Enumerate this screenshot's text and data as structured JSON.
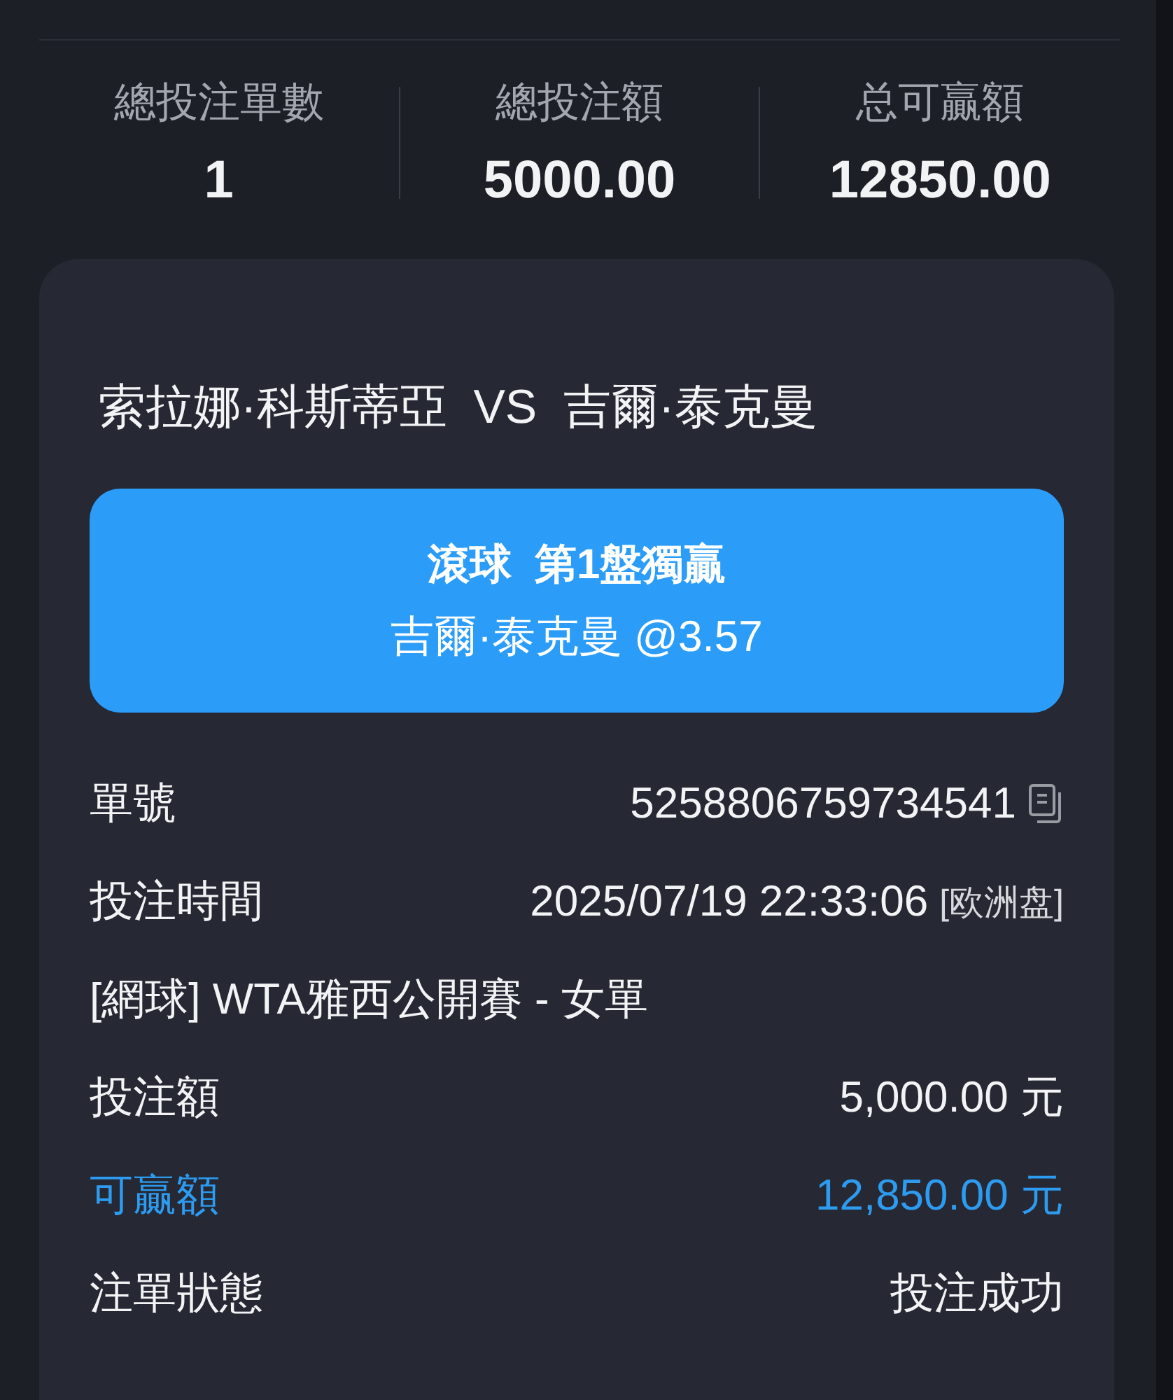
{
  "summary": [
    {
      "label": "總投注單數",
      "value": "1"
    },
    {
      "label": "總投注額",
      "value": "5000.00"
    },
    {
      "label": "总可贏額",
      "value": "12850.00"
    }
  ],
  "bet": {
    "match": "索拉娜·科斯蒂亞  VS  吉爾·泰克曼",
    "market": "滾球  第1盤獨贏",
    "selection": "吉爾·泰克曼 @3.57",
    "rows": [
      {
        "kind": "copy",
        "label": "單號",
        "value": "5258806759734541"
      },
      {
        "kind": "time",
        "label": "投注時間",
        "value": "2025/07/19 22:33:06",
        "note": "[欧洲盘]"
      },
      {
        "kind": "full",
        "label": "[網球] WTA雅西公開賽 - 女單"
      },
      {
        "kind": "plain",
        "label": "投注額",
        "value": "5,000.00 元"
      },
      {
        "kind": "highlight",
        "label": "可贏額",
        "value": "12,850.00 元"
      },
      {
        "kind": "plain",
        "label": "注單狀態",
        "value": "投注成功"
      }
    ]
  }
}
